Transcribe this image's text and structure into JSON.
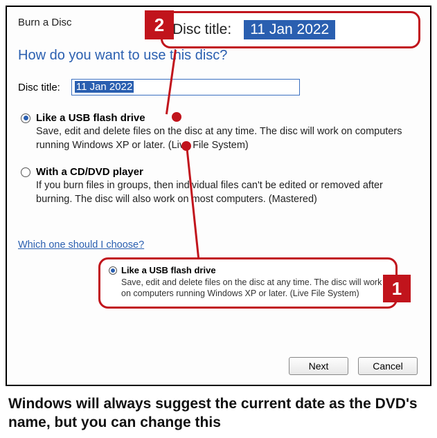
{
  "windowTitle": "Burn a Disc",
  "heading": "How do you want to use this disc?",
  "discTitle": {
    "label": "Disc title:",
    "value": "11 Jan 2022"
  },
  "options": {
    "usb": {
      "label": "Like a USB flash drive",
      "desc": "Save, edit and delete files on the disc at any time. The disc will work on computers running Windows XP or later. (Live File System)"
    },
    "cddvd": {
      "label": "With a CD/DVD player",
      "desc": "If you burn files in groups, then individual files can't be edited or removed after burning. The disc will also work on most computers. (Mastered)"
    }
  },
  "link": "Which one should I choose?",
  "buttons": {
    "next": "Next",
    "cancel": "Cancel"
  },
  "callout2": {
    "badge": "2",
    "label": "Disc title:",
    "value": "11 Jan 2022"
  },
  "callout1": {
    "badge": "1",
    "label": "Like a USB flash drive",
    "desc": "Save, edit and delete files on the disc at any time. The disc will work on computers running Windows XP or later. (Live File System)"
  },
  "caption": "Windows will always suggest the current date as the DVD's name, but you can change this"
}
